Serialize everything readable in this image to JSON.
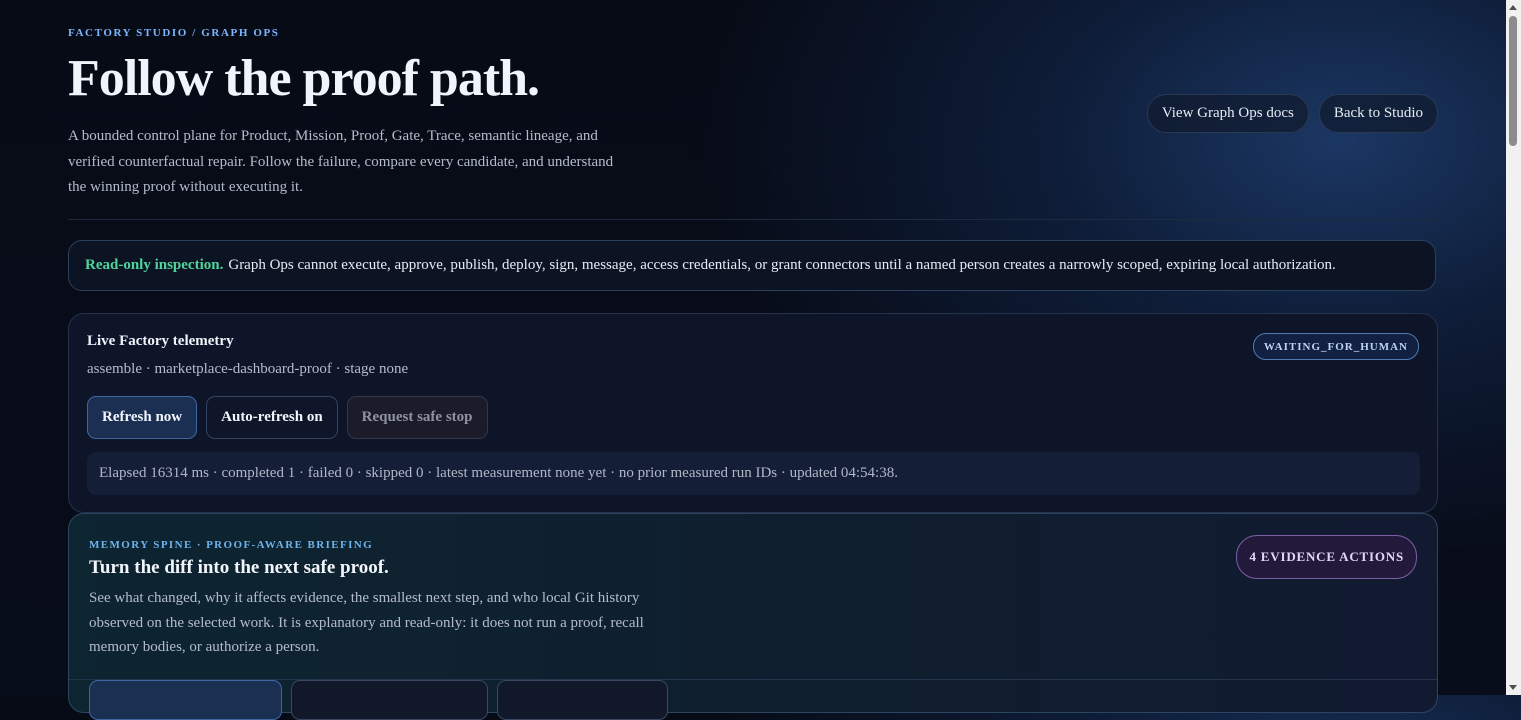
{
  "header": {
    "eyebrow": "FACTORY STUDIO / GRAPH OPS",
    "title": "Follow the proof path.",
    "description": "A bounded control plane for Product, Mission, Proof, Gate, Trace, semantic lineage, and verified counterfactual repair. Follow the failure, compare every candidate, and understand the winning proof without executing it.",
    "docs_button": "View Graph Ops docs",
    "back_button": "Back to Studio"
  },
  "notice": {
    "label": "Read-only inspection.",
    "text": "Graph Ops cannot execute, approve, publish, deploy, sign, message, access credentials, or grant connectors until a named person creates a narrowly scoped, expiring local authorization."
  },
  "telemetry": {
    "title": "Live Factory telemetry",
    "meta": "assemble · marketplace-dashboard-proof · stage none",
    "status": "WAITING_FOR_HUMAN",
    "refresh_button": "Refresh now",
    "autorefresh_button": "Auto-refresh on",
    "stop_button": "Request safe stop",
    "summary": "Elapsed 16314 ms · completed 1 · failed 0 · skipped 0 · latest measurement none yet · no prior measured run IDs · updated 04:54:38."
  },
  "memory": {
    "eyebrow": "MEMORY SPINE · PROOF-AWARE BRIEFING",
    "title": "Turn the diff into the next safe proof.",
    "description": "See what changed, why it affects evidence, the smallest next step, and who local Git history observed on the selected work. It is explanatory and read-only: it does not run a proof, recall memory bodies, or authorize a person.",
    "evidence_badge": "4 EVIDENCE ACTIONS"
  }
}
